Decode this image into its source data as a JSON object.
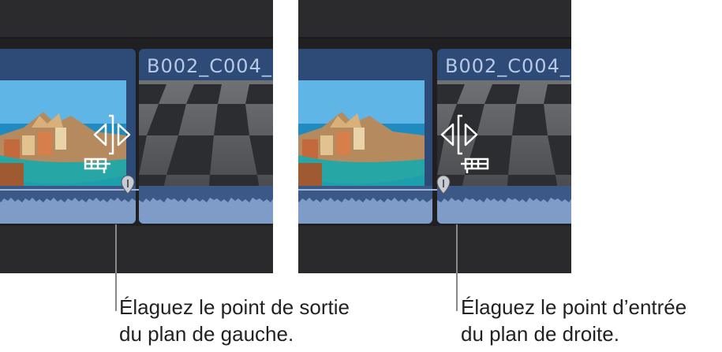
{
  "left_panel": {
    "clip_name": "B002_C004_",
    "annotation_lines": [
      "Élaguez le point de sortie",
      "du plan de gauche."
    ]
  },
  "right_panel": {
    "clip_name": "B002_C004_",
    "annotation_lines": [
      "Élaguez le point d’entrée",
      "du plan de droite."
    ]
  },
  "icons": [
    "trim-end-cursor-icon",
    "trim-start-cursor-icon",
    "filmstrip-icon",
    "marker-icon"
  ],
  "colors": {
    "timeline_bg": "#202022",
    "clip_blue": "#2e4a76",
    "audio_wave": "#7f9cc9",
    "clip_name_text": "#b7c9e6"
  }
}
